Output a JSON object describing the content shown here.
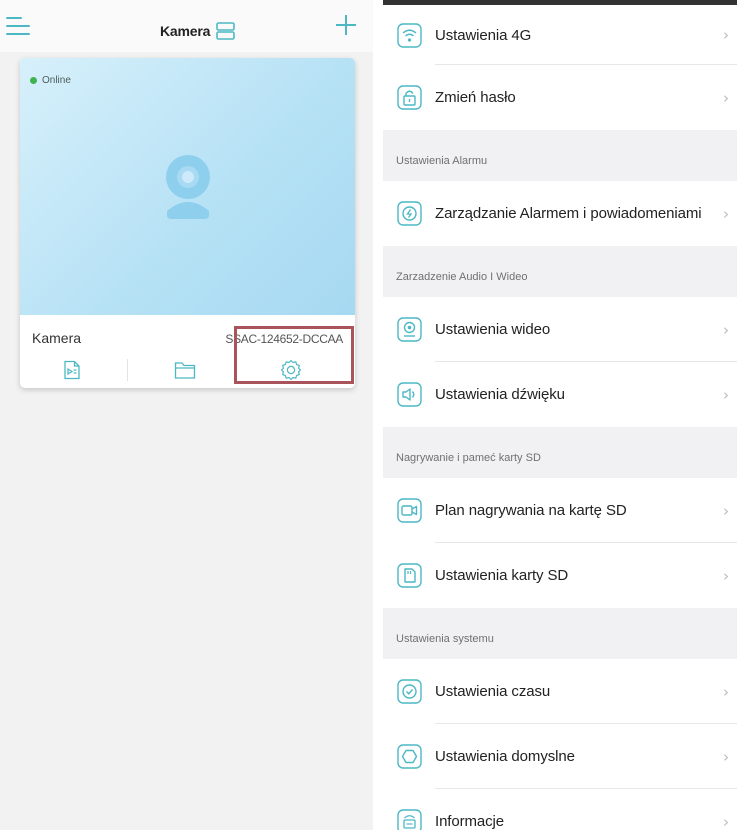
{
  "left": {
    "header": {
      "title": "Kamera",
      "menu_icon": "hamburger-menu-icon",
      "layout_icon": "split-layout-icon",
      "add_icon": "plus-icon"
    },
    "camera_card": {
      "status": "Online",
      "name": "Kamera",
      "device_id": "SSAC-124652-DCCAA",
      "actions": [
        {
          "icon": "video-playback-icon"
        },
        {
          "icon": "folder-icon"
        },
        {
          "icon": "gear-icon"
        }
      ]
    }
  },
  "right": {
    "rows_top": [
      {
        "label": "Ustawienia 4G",
        "icon": "wifi-signal-icon"
      },
      {
        "label": "Zmień hasło",
        "icon": "lock-icon"
      }
    ],
    "sections": [
      {
        "title": "Ustawienia Alarmu",
        "rows": [
          {
            "label": "Zarządzanie Alarmem i powiadomeniami",
            "icon": "alarm-icon"
          }
        ]
      },
      {
        "title": "Zarzadzenie Audio I Wideo",
        "rows": [
          {
            "label": "Ustawienia wideo",
            "icon": "webcam-icon"
          },
          {
            "label": "Ustawienia dźwięku",
            "icon": "speaker-icon"
          }
        ]
      },
      {
        "title": "Nagrywanie i pameć karty SD",
        "rows": [
          {
            "label": "Plan nagrywania na kartę SD",
            "icon": "video-camera-icon"
          },
          {
            "label": "Ustawienia karty SD",
            "icon": "sd-card-icon"
          }
        ]
      },
      {
        "title": "Ustawienia systemu",
        "rows": [
          {
            "label": "Ustawienia czasu",
            "icon": "clock-check-icon"
          },
          {
            "label": "Ustawienia domyslne",
            "icon": "hexagon-icon"
          },
          {
            "label": "Informacje",
            "icon": "device-info-icon"
          }
        ]
      }
    ],
    "chevron": "›"
  },
  "colors": {
    "accent": "#4cb8c4",
    "online": "#3fb34f",
    "highlight": "#a9545a",
    "section_bg": "#f1f1f3"
  }
}
